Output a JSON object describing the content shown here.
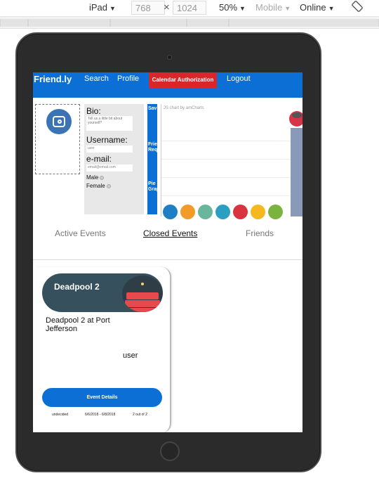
{
  "devtools": {
    "device": "iPad",
    "width_value": "768",
    "height_value": "1024",
    "times": "×",
    "zoom": "50%",
    "mode": "Mobile",
    "network": "Online"
  },
  "nav": {
    "brand": "Friend.ly",
    "search": "Search",
    "profile": "Profile",
    "calendar": "Calendar Authorization",
    "logout": "Logout"
  },
  "profile": {
    "bio_label": "Bio:",
    "bio_placeholder": "Tell us a little bit about yourself?",
    "username_label": "Username:",
    "username_value": "user",
    "email_label": "e-mail:",
    "email_value": "email@email.com",
    "gender_male": "Male",
    "gender_female": "Female"
  },
  "sidebar": {
    "save": "Sav",
    "friend_req": "Frie\nReq",
    "pie_graph": "Pie\nGrap"
  },
  "chart": {
    "credit": "JS chart by amCharts"
  },
  "tabs": {
    "active_events": "Active Events",
    "closed_events": "Closed Events",
    "friends": "Friends"
  },
  "event_card": {
    "title": "Deadpool 2",
    "description": "Deadpool 2 at Port Jefferson",
    "user": "user",
    "details_button": "Event Details",
    "status": "undecided",
    "dates": "6/6/2018 - 6/8/2018",
    "count": "2 out of 2"
  },
  "colors": {
    "nav_blue": "#0c6fd6",
    "calendar_red": "#d9262b",
    "card_header": "#37505e"
  }
}
